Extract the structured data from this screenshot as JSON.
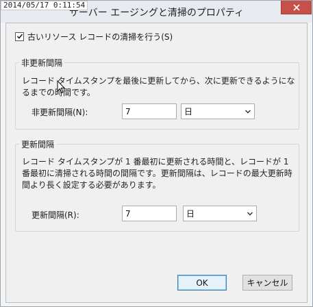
{
  "window": {
    "timestamp": "2014/05/17 0:11:54",
    "title": "サーバー エージングと清掃のプロパティ"
  },
  "scavenge": {
    "checkbox_label": "古いリソース レコードの清掃を行う(S)",
    "checked": true
  },
  "no_refresh": {
    "group_title": "非更新間隔",
    "description": "レコード タイムスタンプを最後に更新してから、次に更新できるようになるまでの時間です。",
    "field_label": "非更新間隔(N):",
    "value": "7",
    "unit": "日"
  },
  "refresh": {
    "group_title": "更新間隔",
    "description": "レコード タイムスタンプが 1 番最初に更新される時間と、レコードが 1 番最初に清掃される時間の間隔です。更新間隔は、レコードの最大更新時間より長く設定する必要があります。",
    "field_label": "更新間隔(R):",
    "value": "7",
    "unit": "日"
  },
  "buttons": {
    "ok": "OK",
    "cancel": "キャンセル"
  },
  "icons": {
    "close": "close-icon",
    "dropdown": "chevron-down-icon",
    "checkmark": "checkmark-icon"
  },
  "colors": {
    "close_button": "#c7504a",
    "default_button_border": "#3c7fb1"
  }
}
